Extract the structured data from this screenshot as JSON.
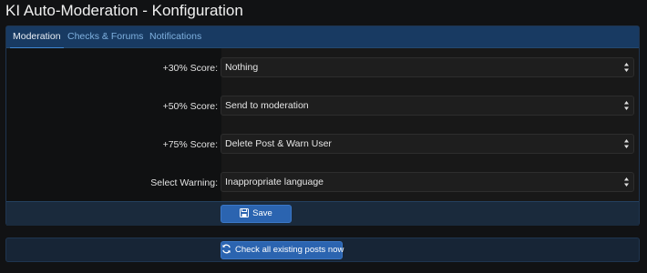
{
  "page": {
    "title": "KI Auto-Moderation - Konfiguration"
  },
  "tabs": [
    {
      "label": "Moderation",
      "active": true
    },
    {
      "label": "Checks & Forums",
      "active": false
    },
    {
      "label": "Notifications",
      "active": false
    }
  ],
  "form": {
    "rows": [
      {
        "label": "+30% Score:",
        "value": "Nothing"
      },
      {
        "label": "+50% Score:",
        "value": "Send to moderation"
      },
      {
        "label": "+75% Score:",
        "value": "Delete Post & Warn User"
      },
      {
        "label": "Select Warning:",
        "value": "Inappropriate language"
      }
    ]
  },
  "buttons": {
    "save_label": "Save",
    "check_label": "Check all existing posts now"
  },
  "colors": {
    "accent": "#2b64b0",
    "tabbar": "#183a62",
    "background": "#111214"
  },
  "icons": {
    "save": "floppy-disk-icon",
    "check": "refresh-icon",
    "select": "sort-arrows-icon"
  }
}
